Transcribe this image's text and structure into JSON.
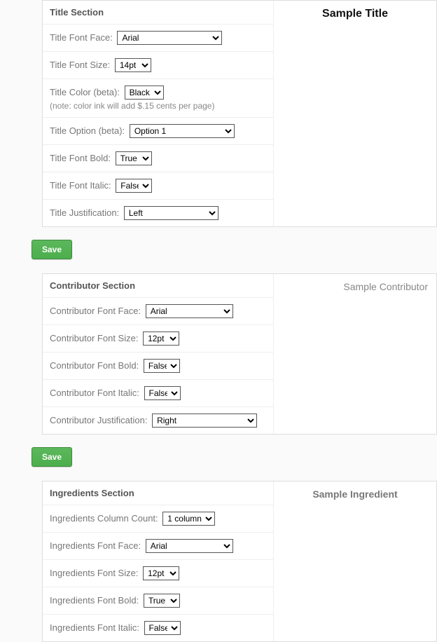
{
  "buttons": {
    "save": "Save"
  },
  "title": {
    "section_header": "Title Section",
    "preview": "Sample Title",
    "font_face_label": "Title Font Face:",
    "font_face_value": "Arial",
    "font_size_label": "Title Font Size:",
    "font_size_value": "14pt",
    "color_label": "Title Color (beta):",
    "color_value": "Black",
    "color_note": "(note: color ink will add $.15 cents per page)",
    "option_label": "Title Option (beta):",
    "option_value": "Option 1",
    "bold_label": "Title Font Bold:",
    "bold_value": "True",
    "italic_label": "Title Font Italic:",
    "italic_value": "False",
    "justify_label": "Title Justification:",
    "justify_value": "Left"
  },
  "contributor": {
    "section_header": "Contributor Section",
    "preview": "Sample Contributor",
    "font_face_label": "Contributor Font Face:",
    "font_face_value": "Arial",
    "font_size_label": "Contributor Font Size:",
    "font_size_value": "12pt",
    "bold_label": "Contributor Font Bold:",
    "bold_value": "False",
    "italic_label": "Contributor Font Italic:",
    "italic_value": "False",
    "justify_label": "Contributor Justification:",
    "justify_value": "Right"
  },
  "ingredients": {
    "section_header": "Ingredients Section",
    "preview": "Sample Ingredient",
    "col_count_label": "Ingredients Column Count:",
    "col_count_value": "1 column",
    "font_face_label": "Ingredients Font Face:",
    "font_face_value": "Arial",
    "font_size_label": "Ingredients Font Size:",
    "font_size_value": "12pt",
    "bold_label": "Ingredients Font Bold:",
    "bold_value": "True",
    "italic_label": "Ingredients Font Italic:",
    "italic_value": "False"
  }
}
